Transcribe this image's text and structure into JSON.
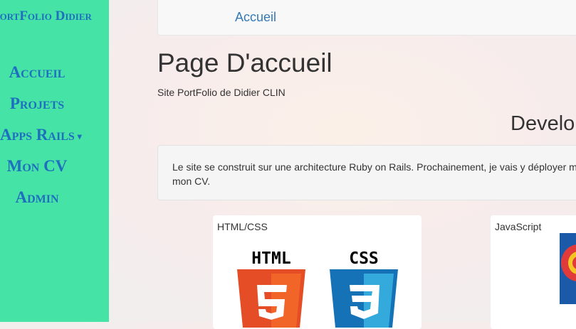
{
  "sidebar": {
    "brand": "PortFolio Didier",
    "items": [
      {
        "label": "Accueil"
      },
      {
        "label": "Projets"
      },
      {
        "label": "Apps Rails"
      },
      {
        "label": "Mon CV"
      },
      {
        "label": "Admin"
      }
    ]
  },
  "topbar": {
    "link": "Accueil"
  },
  "main": {
    "title": "Page D'accueil",
    "subtitle": "Site PortFolio de Didier CLIN",
    "section_heading": "Develo",
    "intro": "Le site se construit sur une architecture Ruby on Rails. Prochainement, je vais y déployer m de mon CV.",
    "cards": [
      {
        "title": "HTML/CSS",
        "logos": [
          "HTML",
          "CSS"
        ]
      },
      {
        "title": "JavaScript"
      }
    ]
  },
  "colors": {
    "sidebar_bg": "#45e3a6",
    "nav_text": "#1f6fbf",
    "link": "#337ab7",
    "html5_orange": "#e44d26",
    "css3_blue": "#1572b6"
  }
}
